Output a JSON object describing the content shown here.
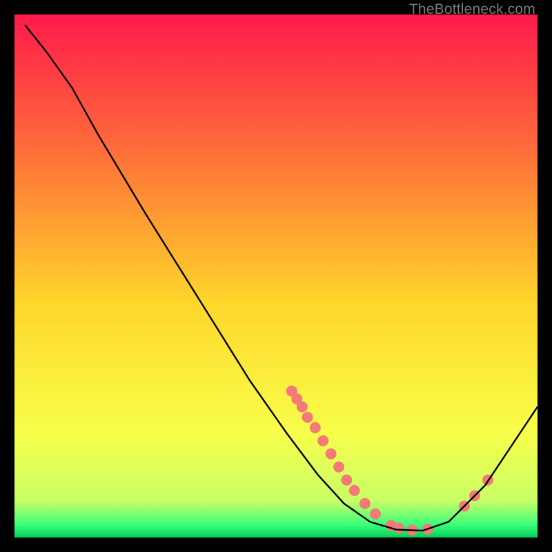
{
  "watermark": "TheBottleneck.com",
  "chart_data": {
    "type": "line",
    "title": "",
    "xlabel": "",
    "ylabel": "",
    "xlim": [
      0,
      100
    ],
    "ylim": [
      0,
      100
    ],
    "gradient_stops": [
      {
        "offset": 0.0,
        "color": "#ff1a4b"
      },
      {
        "offset": 0.25,
        "color": "#ff6a3a"
      },
      {
        "offset": 0.55,
        "color": "#ffd62a"
      },
      {
        "offset": 0.8,
        "color": "#f8ff4a"
      },
      {
        "offset": 0.93,
        "color": "#c8ff66"
      },
      {
        "offset": 0.975,
        "color": "#3dff7a"
      },
      {
        "offset": 1.0,
        "color": "#00d05a"
      }
    ],
    "series": [
      {
        "name": "curve",
        "color": "#000000",
        "points": [
          {
            "x": 2.0,
            "y": 98.0
          },
          {
            "x": 6.0,
            "y": 93.0
          },
          {
            "x": 11.0,
            "y": 86.0
          },
          {
            "x": 16.0,
            "y": 77.0
          },
          {
            "x": 25.0,
            "y": 62.0
          },
          {
            "x": 35.0,
            "y": 46.0
          },
          {
            "x": 45.0,
            "y": 30.0
          },
          {
            "x": 52.0,
            "y": 20.0
          },
          {
            "x": 58.0,
            "y": 12.0
          },
          {
            "x": 63.0,
            "y": 6.5
          },
          {
            "x": 68.0,
            "y": 3.0
          },
          {
            "x": 73.0,
            "y": 1.5
          },
          {
            "x": 78.0,
            "y": 1.3
          },
          {
            "x": 83.0,
            "y": 3.0
          },
          {
            "x": 90.0,
            "y": 10.0
          },
          {
            "x": 100.0,
            "y": 25.0
          }
        ]
      }
    ],
    "markers": {
      "name": "highlight-points",
      "color": "#f37a77",
      "radius": 8,
      "points": [
        {
          "x": 53.0,
          "y": 28.0
        },
        {
          "x": 54.0,
          "y": 26.5
        },
        {
          "x": 55.0,
          "y": 25.0
        },
        {
          "x": 56.0,
          "y": 23.0
        },
        {
          "x": 57.5,
          "y": 21.0
        },
        {
          "x": 59.0,
          "y": 18.5
        },
        {
          "x": 60.5,
          "y": 16.0
        },
        {
          "x": 62.0,
          "y": 13.5
        },
        {
          "x": 63.5,
          "y": 11.0
        },
        {
          "x": 65.0,
          "y": 9.0
        },
        {
          "x": 67.0,
          "y": 6.5
        },
        {
          "x": 69.0,
          "y": 4.5
        },
        {
          "x": 72.0,
          "y": 2.3
        },
        {
          "x": 73.5,
          "y": 1.8
        },
        {
          "x": 76.0,
          "y": 1.4
        },
        {
          "x": 79.0,
          "y": 1.6
        },
        {
          "x": 86.0,
          "y": 6.0
        },
        {
          "x": 88.0,
          "y": 8.0
        },
        {
          "x": 90.5,
          "y": 11.0
        }
      ]
    }
  }
}
